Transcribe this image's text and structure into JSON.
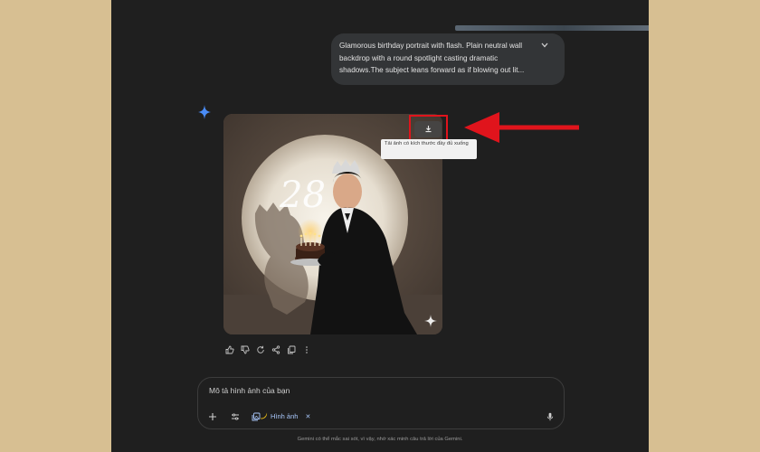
{
  "conversation": {
    "prompt_text": "Glamorous birthday portrait with flash. Plain neutral wall backdrop with a round spotlight casting dramatic shadows.The subject leans forward as if blowing out lit..."
  },
  "generated_image": {
    "cake_number": "28",
    "download_tooltip": "Tải ảnh có kích thước đầy đủ xuống"
  },
  "response_actions": {
    "icons": [
      "thumbs-up-icon",
      "thumbs-down-icon",
      "regenerate-icon",
      "share-icon",
      "copy-icon",
      "more-vert-icon"
    ]
  },
  "composer": {
    "placeholder": "Mô tả hình ảnh của bạn",
    "tool_chip_label": "Hình ảnh",
    "chip_close": "✕"
  },
  "footer": {
    "disclaimer": "Gemini có thể mắc sai sót, vì vậy, nhớ xác minh câu trả lời của Gemini."
  },
  "annotation": {
    "color": "#e0141c"
  },
  "theme": {
    "app_bg": "#1f1f1f",
    "bubble_bg": "#333537",
    "page_bg": "#d7bf92",
    "accent_blue": "#a8c7fa"
  }
}
